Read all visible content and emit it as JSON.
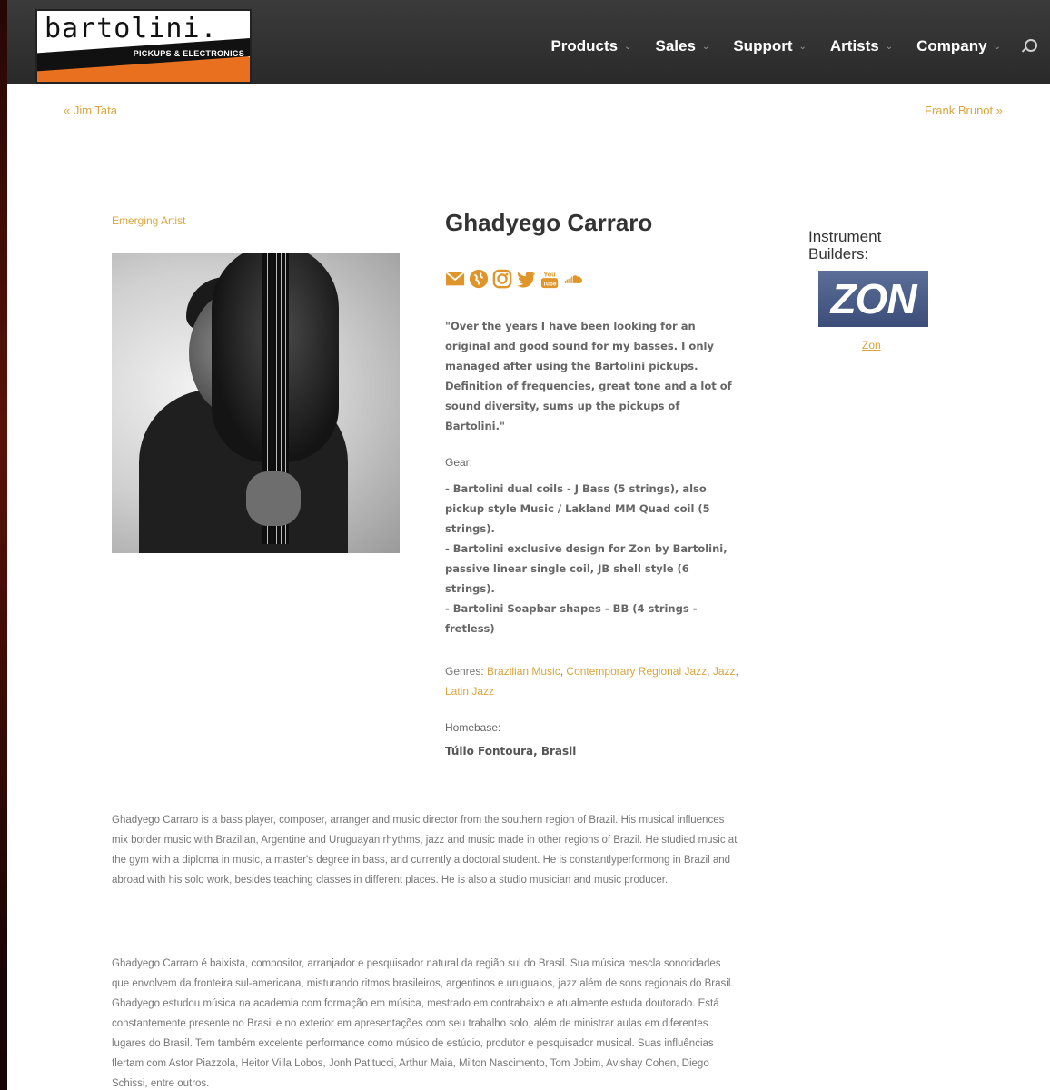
{
  "logo": {
    "brand": "bartolini.",
    "tagline": "PICKUPS & ELECTRONICS"
  },
  "nav": {
    "items": [
      {
        "label": "Products"
      },
      {
        "label": "Sales"
      },
      {
        "label": "Support"
      },
      {
        "label": "Artists"
      },
      {
        "label": "Company"
      }
    ],
    "chevron": "⌄",
    "search_icon": "search-icon"
  },
  "post_nav": {
    "prev": "« Jim Tata",
    "next": "Frank Brunot »"
  },
  "artist": {
    "category": "Emerging Artist",
    "name": "Ghadyego Carraro",
    "social_icons": [
      "email-icon",
      "globe-icon",
      "instagram-icon",
      "twitter-icon",
      "youtube-icon",
      "soundcloud-icon"
    ],
    "quote": "\"Over the years I have been looking for an original and good sound for my basses. I only managed after using the Bartolini pickups. Definition of frequencies, great tone and a lot of sound diversity, sums up the pickups of Bartolini.\"",
    "gear_label": "Gear:",
    "gear": [
      "- Bartolini dual coils - J Bass (5 strings), also pickup style Music / Lakland MM Quad coil (5 strings).",
      "- Bartolini exclusive design for Zon by Bartolini, passive linear single coil, JB shell style (6 strings).",
      "- Bartolini Soapbar shapes - BB (4 strings - fretless)"
    ],
    "genres_label": "Genres:",
    "genres": [
      "Brazilian Music",
      "Contemporary Regional Jazz",
      "Jazz",
      "Latin Jazz"
    ],
    "homebase_label": "Homebase:",
    "homebase": "Túlio Fontoura, Brasil"
  },
  "sidebar": {
    "title": "Instrument Builders:",
    "builder_logo_text": "ZON",
    "builder_link": "Zon"
  },
  "bio": {
    "english": "Ghadyego Carraro is a bass player, composer, arranger and music director from the southern region of Brazil. His musical influences mix border music with Brazilian, Argentine and Uruguayan rhythms, jazz and music made in other regions of Brazil. He studied music at the gym with a diploma in music, a master's degree in bass, and currently a doctoral student. He is constantlyperformong in Brazil and abroad with his solo work, besides teaching classes in different places. He is also a studio musician and music producer.",
    "portuguese": "Ghadyego Carraro é baixista, compositor, arranjador e pesquisador natural da região sul do Brasil. Sua música mescla sonoridades que envolvem da fronteira sul-americana, misturando ritmos brasileiros, argentinos e uruguaios, jazz além de sons regionais do Brasil. Ghadyego estudou música na academia com formação em música, mestrado em contrabaixo e atualmente estuda doutorado. Está constantemente presente no Brasil e no exterior em apresentações com seu trabalho solo, além de ministrar aulas em diferentes lugares do Brasil. Tem também excelente performance como músico de estúdio, produtor e pesquisador musical. Suas influências flertam com Astor Piazzola, Heitor Villa Lobos, Jonh Patitucci, Arthur Maia, Milton Nascimento, Tom Jobim, Avishay Cohen, Diego Schissi, entre outros."
  },
  "colors": {
    "accent": "#d9a53c",
    "header_bg": "#333333",
    "logo_orange": "#e8701f"
  }
}
